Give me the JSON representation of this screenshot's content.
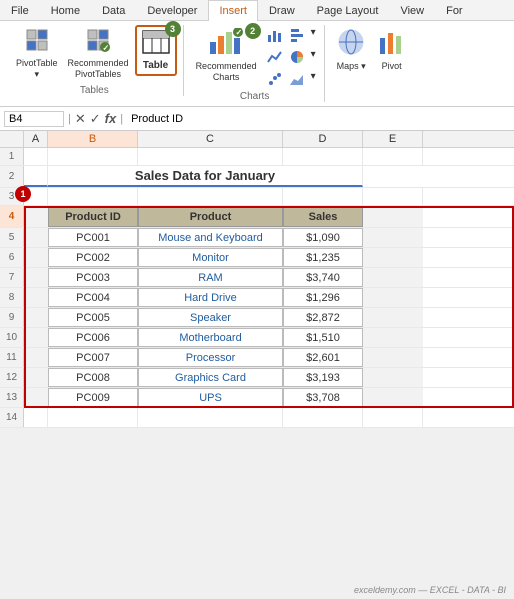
{
  "tabs": [
    {
      "label": "File",
      "active": false
    },
    {
      "label": "Home",
      "active": false
    },
    {
      "label": "Data",
      "active": false
    },
    {
      "label": "Developer",
      "active": false
    },
    {
      "label": "Insert",
      "active": true
    },
    {
      "label": "Draw",
      "active": false
    },
    {
      "label": "Page Layout",
      "active": false
    },
    {
      "label": "View",
      "active": false
    },
    {
      "label": "For",
      "active": false
    }
  ],
  "ribbon_groups": {
    "tables": {
      "label": "Tables",
      "buttons": [
        {
          "id": "pivot-table",
          "label": "PivotTable",
          "icon": "⊞"
        },
        {
          "id": "recommended-pivot",
          "label": "Recommended\nPivotTables",
          "icon": "⊟"
        },
        {
          "id": "table",
          "label": "Table",
          "icon": "⊞",
          "outlined": true,
          "badge": "3"
        }
      ]
    },
    "charts": {
      "label": "Charts",
      "buttons": [
        {
          "id": "recommended-charts",
          "label": "Recommended\nCharts",
          "icon": "📊",
          "badge": "2"
        }
      ]
    }
  },
  "formula_bar": {
    "cell_ref": "B4",
    "formula": "Product ID",
    "icons": [
      "✕",
      "✓",
      "fx"
    ]
  },
  "spreadsheet": {
    "title": "Sales Data for January",
    "headers": [
      "Product ID",
      "Product",
      "Sales"
    ],
    "rows": [
      {
        "id": "PC001",
        "product": "Mouse and Keyboard",
        "sales": "$1,090"
      },
      {
        "id": "PC002",
        "product": "Monitor",
        "sales": "$1,235"
      },
      {
        "id": "PC003",
        "product": "RAM",
        "sales": "$3,740"
      },
      {
        "id": "PC004",
        "product": "Hard Drive",
        "sales": "$1,296"
      },
      {
        "id": "PC005",
        "product": "Speaker",
        "sales": "$2,872"
      },
      {
        "id": "PC006",
        "product": "Motherboard",
        "sales": "$1,510"
      },
      {
        "id": "PC007",
        "product": "Processor",
        "sales": "$2,601"
      },
      {
        "id": "PC008",
        "product": "Graphics Card",
        "sales": "$3,193"
      },
      {
        "id": "PC009",
        "product": "UPS",
        "sales": "$3,708"
      }
    ]
  },
  "badge_colors": {
    "1": "#c00000",
    "2": "#538135",
    "3": "#538135"
  },
  "columns": [
    "A",
    "B",
    "C",
    "D",
    "E"
  ]
}
